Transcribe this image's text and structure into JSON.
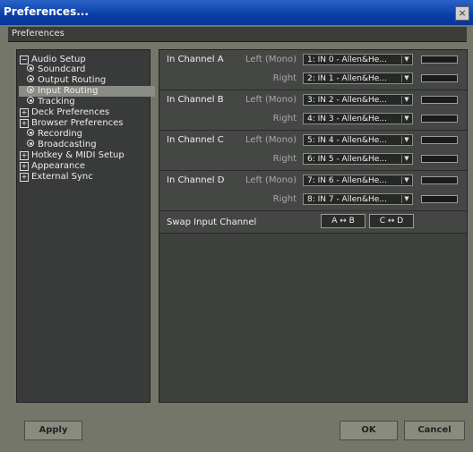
{
  "window": {
    "title": "Preferences...",
    "close_glyph": "×"
  },
  "header": {
    "title": "Preferences"
  },
  "sidebar": {
    "items": [
      {
        "label": "Audio Setup",
        "icon": "minus-box-icon",
        "glyph": "−"
      },
      {
        "label": "Soundcard",
        "icon": "bullet-icon"
      },
      {
        "label": "Output Routing",
        "icon": "bullet-icon"
      },
      {
        "label": "Input Routing",
        "icon": "bullet-icon",
        "selected": true
      },
      {
        "label": "Tracking",
        "icon": "bullet-icon"
      },
      {
        "label": "Deck Preferences",
        "icon": "plus-box-icon",
        "glyph": "+"
      },
      {
        "label": "Browser Preferences",
        "icon": "plus-box-icon",
        "glyph": "+"
      },
      {
        "label": "Recording",
        "icon": "bullet-icon"
      },
      {
        "label": "Broadcasting",
        "icon": "bullet-icon"
      },
      {
        "label": "Hotkey & MIDI Setup",
        "icon": "plus-box-icon",
        "glyph": "+"
      },
      {
        "label": "Appearance",
        "icon": "plus-box-icon",
        "glyph": "+"
      },
      {
        "label": "External Sync",
        "icon": "plus-box-icon",
        "glyph": "+"
      }
    ]
  },
  "channels": [
    {
      "label": "In Channel A",
      "left_label": "Left (Mono)",
      "left_value": "1: IN 0 - Allen&He...",
      "right_label": "Right",
      "right_value": "2: IN 1 - Allen&He..."
    },
    {
      "label": "In Channel B",
      "left_label": "Left (Mono)",
      "left_value": "3: IN 2 - Allen&He...",
      "right_label": "Right",
      "right_value": "4: IN 3 - Allen&He..."
    },
    {
      "label": "In Channel C",
      "left_label": "Left (Mono)",
      "left_value": "5: IN 4 - Allen&He...",
      "right_label": "Right",
      "right_value": "6: IN 5 - Allen&He..."
    },
    {
      "label": "In Channel D",
      "left_label": "Left (Mono)",
      "left_value": "7: IN 6 - Allen&He...",
      "right_label": "Right",
      "right_value": "8: IN 7 - Allen&He..."
    }
  ],
  "dropdown_arrow": "▼",
  "swap": {
    "label": "Swap Input Channel",
    "ab": "A ↔ B",
    "cd": "C ↔ D"
  },
  "buttons": {
    "apply": "Apply",
    "ok": "OK",
    "cancel": "Cancel"
  },
  "colors": {
    "titlebar": "#0b3ea8",
    "selected": "#8a8c86",
    "panel": "#3e403e"
  }
}
